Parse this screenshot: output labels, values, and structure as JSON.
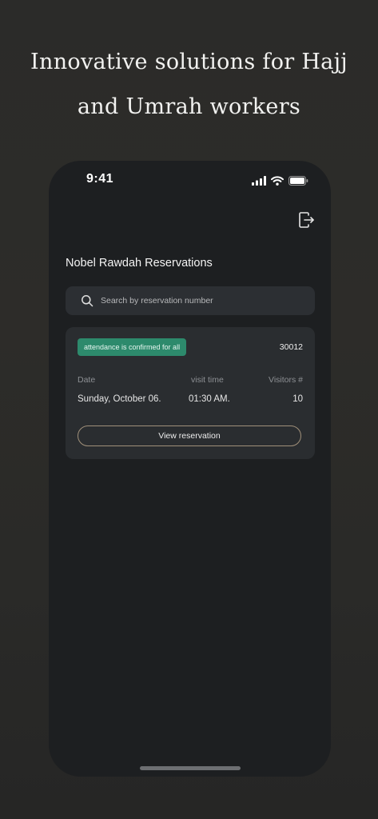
{
  "promo": {
    "line1": "Innovative solutions for Hajj",
    "line2": "and Umrah workers"
  },
  "status_bar": {
    "time": "9:41",
    "icons": [
      "cellular-signal-icon",
      "wifi-icon",
      "battery-icon"
    ]
  },
  "header": {
    "logout_icon": "logout-icon",
    "title": "Nobel Rawdah Reservations"
  },
  "search": {
    "placeholder": "Search by reservation number",
    "value": ""
  },
  "reservation": {
    "status": "attendance is confirmed for all",
    "number": "30012",
    "columns": {
      "date_label": "Date",
      "time_label": "visit time",
      "visitors_label": "Visitors #"
    },
    "values": {
      "date": "Sunday, October 06.",
      "time": "01:30 AM.",
      "visitors": "10"
    },
    "action_label": "View reservation"
  },
  "colors": {
    "background": "#2b2b29",
    "phone_screen": "#1d1f21",
    "card": "#2a2d30",
    "status_badge": "#2d8a6c",
    "button_border": "#a0907a"
  }
}
